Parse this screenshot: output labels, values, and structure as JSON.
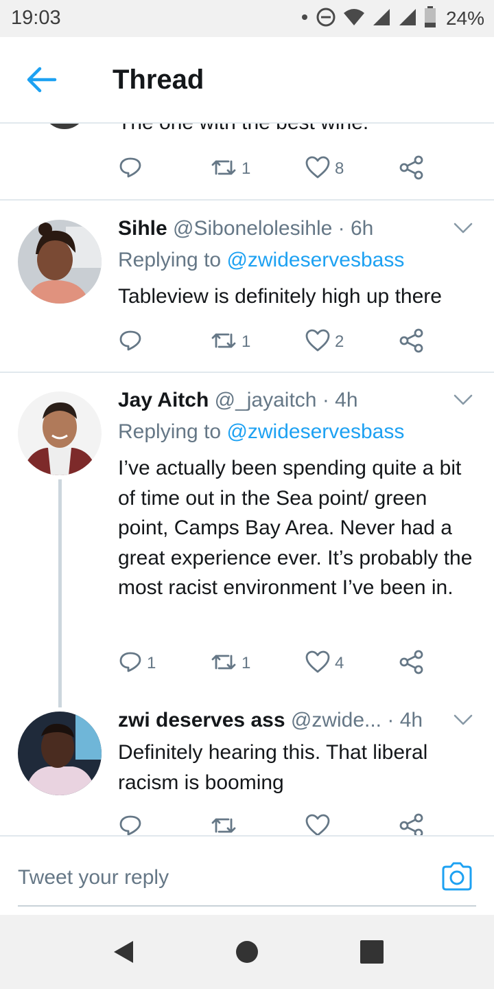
{
  "status_bar": {
    "time": "19:03",
    "battery": "24%"
  },
  "header": {
    "title": "Thread"
  },
  "first_tweet": {
    "text": "The one with the best wine.",
    "replies": "",
    "retweets": "1",
    "likes": "8"
  },
  "tweets": [
    {
      "name": "Sihle",
      "handle": "@Sibonelolesihle",
      "time": "· 6h",
      "replying_label": "Replying to",
      "replying_to": "@zwideservesbass",
      "text": "Tableview is definitely high up there",
      "replies": "",
      "retweets": "1",
      "likes": "2"
    },
    {
      "name": "Jay Aitch",
      "handle": "@_jayaitch",
      "time": "· 4h",
      "replying_label": "Replying to",
      "replying_to": "@zwideservesbass",
      "text": "I’ve actually been spending quite a bit of time out in the Sea point/ green point, Camps Bay Area. Never had a great experience ever. It’s probably the most racist environment I’ve been in.",
      "replies": "1",
      "retweets": "1",
      "likes": "4"
    },
    {
      "name": "zwi deserves ass",
      "handle": "@zwide...",
      "time": "· 4h",
      "text": "Definitely hearing this. That liberal racism is booming",
      "replies": "",
      "retweets": "",
      "likes": ""
    }
  ],
  "composer": {
    "placeholder": "Tweet your reply"
  },
  "colors": {
    "accent": "#1da1f2",
    "muted": "#657786",
    "text": "#14171a",
    "divider": "#e1e8ed"
  },
  "icons": [
    "back-arrow-icon",
    "reply-icon",
    "retweet-icon",
    "like-icon",
    "share-icon",
    "chevron-down-icon",
    "camera-icon",
    "nav-back-icon",
    "nav-home-icon",
    "nav-recents-icon"
  ]
}
